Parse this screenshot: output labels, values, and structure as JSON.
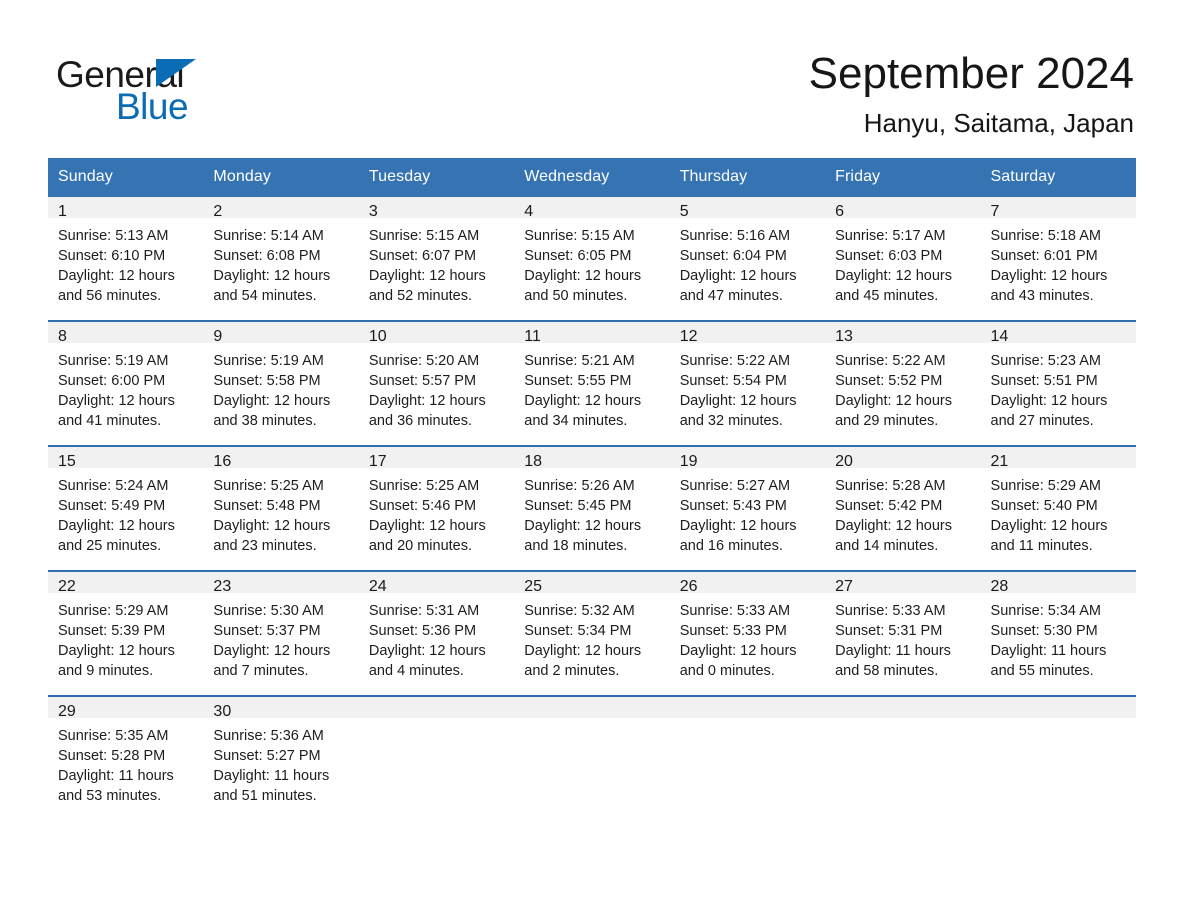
{
  "brand": {
    "name_part1": "General",
    "name_part2": "Blue",
    "triangle_color": "#0a6cb4",
    "text_color": "#1a1a1a"
  },
  "header": {
    "month_title": "September 2024",
    "location": "Hanyu, Saitama, Japan"
  },
  "theme": {
    "header_blue": "#3573b2",
    "rule_blue": "#2f6fb0",
    "daynum_bg": "#f1f1f1",
    "page_bg": "#ffffff"
  },
  "calendar": {
    "weekday_headers": [
      "Sunday",
      "Monday",
      "Tuesday",
      "Wednesday",
      "Thursday",
      "Friday",
      "Saturday"
    ],
    "labels": {
      "sunrise_prefix": "Sunrise: ",
      "sunset_prefix": "Sunset: ",
      "daylight_prefix": "Daylight: "
    },
    "weeks": [
      [
        {
          "day": "1",
          "sunrise": "Sunrise: 5:13 AM",
          "sunset": "Sunset: 6:10 PM",
          "daylight": "Daylight: 12 hours and 56 minutes."
        },
        {
          "day": "2",
          "sunrise": "Sunrise: 5:14 AM",
          "sunset": "Sunset: 6:08 PM",
          "daylight": "Daylight: 12 hours and 54 minutes."
        },
        {
          "day": "3",
          "sunrise": "Sunrise: 5:15 AM",
          "sunset": "Sunset: 6:07 PM",
          "daylight": "Daylight: 12 hours and 52 minutes."
        },
        {
          "day": "4",
          "sunrise": "Sunrise: 5:15 AM",
          "sunset": "Sunset: 6:05 PM",
          "daylight": "Daylight: 12 hours and 50 minutes."
        },
        {
          "day": "5",
          "sunrise": "Sunrise: 5:16 AM",
          "sunset": "Sunset: 6:04 PM",
          "daylight": "Daylight: 12 hours and 47 minutes."
        },
        {
          "day": "6",
          "sunrise": "Sunrise: 5:17 AM",
          "sunset": "Sunset: 6:03 PM",
          "daylight": "Daylight: 12 hours and 45 minutes."
        },
        {
          "day": "7",
          "sunrise": "Sunrise: 5:18 AM",
          "sunset": "Sunset: 6:01 PM",
          "daylight": "Daylight: 12 hours and 43 minutes."
        }
      ],
      [
        {
          "day": "8",
          "sunrise": "Sunrise: 5:19 AM",
          "sunset": "Sunset: 6:00 PM",
          "daylight": "Daylight: 12 hours and 41 minutes."
        },
        {
          "day": "9",
          "sunrise": "Sunrise: 5:19 AM",
          "sunset": "Sunset: 5:58 PM",
          "daylight": "Daylight: 12 hours and 38 minutes."
        },
        {
          "day": "10",
          "sunrise": "Sunrise: 5:20 AM",
          "sunset": "Sunset: 5:57 PM",
          "daylight": "Daylight: 12 hours and 36 minutes."
        },
        {
          "day": "11",
          "sunrise": "Sunrise: 5:21 AM",
          "sunset": "Sunset: 5:55 PM",
          "daylight": "Daylight: 12 hours and 34 minutes."
        },
        {
          "day": "12",
          "sunrise": "Sunrise: 5:22 AM",
          "sunset": "Sunset: 5:54 PM",
          "daylight": "Daylight: 12 hours and 32 minutes."
        },
        {
          "day": "13",
          "sunrise": "Sunrise: 5:22 AM",
          "sunset": "Sunset: 5:52 PM",
          "daylight": "Daylight: 12 hours and 29 minutes."
        },
        {
          "day": "14",
          "sunrise": "Sunrise: 5:23 AM",
          "sunset": "Sunset: 5:51 PM",
          "daylight": "Daylight: 12 hours and 27 minutes."
        }
      ],
      [
        {
          "day": "15",
          "sunrise": "Sunrise: 5:24 AM",
          "sunset": "Sunset: 5:49 PM",
          "daylight": "Daylight: 12 hours and 25 minutes."
        },
        {
          "day": "16",
          "sunrise": "Sunrise: 5:25 AM",
          "sunset": "Sunset: 5:48 PM",
          "daylight": "Daylight: 12 hours and 23 minutes."
        },
        {
          "day": "17",
          "sunrise": "Sunrise: 5:25 AM",
          "sunset": "Sunset: 5:46 PM",
          "daylight": "Daylight: 12 hours and 20 minutes."
        },
        {
          "day": "18",
          "sunrise": "Sunrise: 5:26 AM",
          "sunset": "Sunset: 5:45 PM",
          "daylight": "Daylight: 12 hours and 18 minutes."
        },
        {
          "day": "19",
          "sunrise": "Sunrise: 5:27 AM",
          "sunset": "Sunset: 5:43 PM",
          "daylight": "Daylight: 12 hours and 16 minutes."
        },
        {
          "day": "20",
          "sunrise": "Sunrise: 5:28 AM",
          "sunset": "Sunset: 5:42 PM",
          "daylight": "Daylight: 12 hours and 14 minutes."
        },
        {
          "day": "21",
          "sunrise": "Sunrise: 5:29 AM",
          "sunset": "Sunset: 5:40 PM",
          "daylight": "Daylight: 12 hours and 11 minutes."
        }
      ],
      [
        {
          "day": "22",
          "sunrise": "Sunrise: 5:29 AM",
          "sunset": "Sunset: 5:39 PM",
          "daylight": "Daylight: 12 hours and 9 minutes."
        },
        {
          "day": "23",
          "sunrise": "Sunrise: 5:30 AM",
          "sunset": "Sunset: 5:37 PM",
          "daylight": "Daylight: 12 hours and 7 minutes."
        },
        {
          "day": "24",
          "sunrise": "Sunrise: 5:31 AM",
          "sunset": "Sunset: 5:36 PM",
          "daylight": "Daylight: 12 hours and 4 minutes."
        },
        {
          "day": "25",
          "sunrise": "Sunrise: 5:32 AM",
          "sunset": "Sunset: 5:34 PM",
          "daylight": "Daylight: 12 hours and 2 minutes."
        },
        {
          "day": "26",
          "sunrise": "Sunrise: 5:33 AM",
          "sunset": "Sunset: 5:33 PM",
          "daylight": "Daylight: 12 hours and 0 minutes."
        },
        {
          "day": "27",
          "sunrise": "Sunrise: 5:33 AM",
          "sunset": "Sunset: 5:31 PM",
          "daylight": "Daylight: 11 hours and 58 minutes."
        },
        {
          "day": "28",
          "sunrise": "Sunrise: 5:34 AM",
          "sunset": "Sunset: 5:30 PM",
          "daylight": "Daylight: 11 hours and 55 minutes."
        }
      ],
      [
        {
          "day": "29",
          "sunrise": "Sunrise: 5:35 AM",
          "sunset": "Sunset: 5:28 PM",
          "daylight": "Daylight: 11 hours and 53 minutes."
        },
        {
          "day": "30",
          "sunrise": "Sunrise: 5:36 AM",
          "sunset": "Sunset: 5:27 PM",
          "daylight": "Daylight: 11 hours and 51 minutes."
        },
        {
          "day": "",
          "sunrise": "",
          "sunset": "",
          "daylight": ""
        },
        {
          "day": "",
          "sunrise": "",
          "sunset": "",
          "daylight": ""
        },
        {
          "day": "",
          "sunrise": "",
          "sunset": "",
          "daylight": ""
        },
        {
          "day": "",
          "sunrise": "",
          "sunset": "",
          "daylight": ""
        },
        {
          "day": "",
          "sunrise": "",
          "sunset": "",
          "daylight": ""
        }
      ]
    ]
  }
}
